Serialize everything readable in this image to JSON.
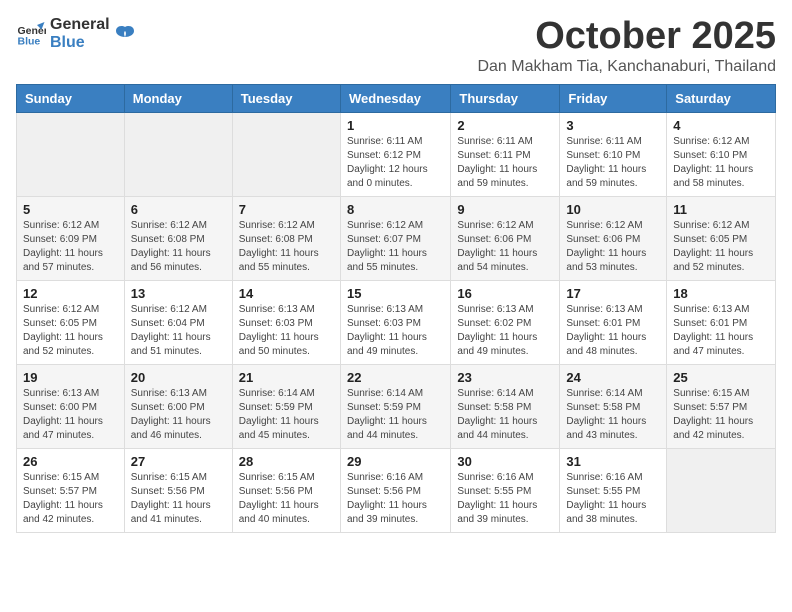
{
  "logo": {
    "general": "General",
    "blue": "Blue"
  },
  "header": {
    "month": "October 2025",
    "location": "Dan Makham Tia, Kanchanaburi, Thailand"
  },
  "weekdays": [
    "Sunday",
    "Monday",
    "Tuesday",
    "Wednesday",
    "Thursday",
    "Friday",
    "Saturday"
  ],
  "weeks": [
    [
      {
        "day": "",
        "sunrise": "",
        "sunset": "",
        "daylight": ""
      },
      {
        "day": "",
        "sunrise": "",
        "sunset": "",
        "daylight": ""
      },
      {
        "day": "",
        "sunrise": "",
        "sunset": "",
        "daylight": ""
      },
      {
        "day": "1",
        "sunrise": "Sunrise: 6:11 AM",
        "sunset": "Sunset: 6:12 PM",
        "daylight": "Daylight: 12 hours and 0 minutes."
      },
      {
        "day": "2",
        "sunrise": "Sunrise: 6:11 AM",
        "sunset": "Sunset: 6:11 PM",
        "daylight": "Daylight: 11 hours and 59 minutes."
      },
      {
        "day": "3",
        "sunrise": "Sunrise: 6:11 AM",
        "sunset": "Sunset: 6:10 PM",
        "daylight": "Daylight: 11 hours and 59 minutes."
      },
      {
        "day": "4",
        "sunrise": "Sunrise: 6:12 AM",
        "sunset": "Sunset: 6:10 PM",
        "daylight": "Daylight: 11 hours and 58 minutes."
      }
    ],
    [
      {
        "day": "5",
        "sunrise": "Sunrise: 6:12 AM",
        "sunset": "Sunset: 6:09 PM",
        "daylight": "Daylight: 11 hours and 57 minutes."
      },
      {
        "day": "6",
        "sunrise": "Sunrise: 6:12 AM",
        "sunset": "Sunset: 6:08 PM",
        "daylight": "Daylight: 11 hours and 56 minutes."
      },
      {
        "day": "7",
        "sunrise": "Sunrise: 6:12 AM",
        "sunset": "Sunset: 6:08 PM",
        "daylight": "Daylight: 11 hours and 55 minutes."
      },
      {
        "day": "8",
        "sunrise": "Sunrise: 6:12 AM",
        "sunset": "Sunset: 6:07 PM",
        "daylight": "Daylight: 11 hours and 55 minutes."
      },
      {
        "day": "9",
        "sunrise": "Sunrise: 6:12 AM",
        "sunset": "Sunset: 6:06 PM",
        "daylight": "Daylight: 11 hours and 54 minutes."
      },
      {
        "day": "10",
        "sunrise": "Sunrise: 6:12 AM",
        "sunset": "Sunset: 6:06 PM",
        "daylight": "Daylight: 11 hours and 53 minutes."
      },
      {
        "day": "11",
        "sunrise": "Sunrise: 6:12 AM",
        "sunset": "Sunset: 6:05 PM",
        "daylight": "Daylight: 11 hours and 52 minutes."
      }
    ],
    [
      {
        "day": "12",
        "sunrise": "Sunrise: 6:12 AM",
        "sunset": "Sunset: 6:05 PM",
        "daylight": "Daylight: 11 hours and 52 minutes."
      },
      {
        "day": "13",
        "sunrise": "Sunrise: 6:12 AM",
        "sunset": "Sunset: 6:04 PM",
        "daylight": "Daylight: 11 hours and 51 minutes."
      },
      {
        "day": "14",
        "sunrise": "Sunrise: 6:13 AM",
        "sunset": "Sunset: 6:03 PM",
        "daylight": "Daylight: 11 hours and 50 minutes."
      },
      {
        "day": "15",
        "sunrise": "Sunrise: 6:13 AM",
        "sunset": "Sunset: 6:03 PM",
        "daylight": "Daylight: 11 hours and 49 minutes."
      },
      {
        "day": "16",
        "sunrise": "Sunrise: 6:13 AM",
        "sunset": "Sunset: 6:02 PM",
        "daylight": "Daylight: 11 hours and 49 minutes."
      },
      {
        "day": "17",
        "sunrise": "Sunrise: 6:13 AM",
        "sunset": "Sunset: 6:01 PM",
        "daylight": "Daylight: 11 hours and 48 minutes."
      },
      {
        "day": "18",
        "sunrise": "Sunrise: 6:13 AM",
        "sunset": "Sunset: 6:01 PM",
        "daylight": "Daylight: 11 hours and 47 minutes."
      }
    ],
    [
      {
        "day": "19",
        "sunrise": "Sunrise: 6:13 AM",
        "sunset": "Sunset: 6:00 PM",
        "daylight": "Daylight: 11 hours and 47 minutes."
      },
      {
        "day": "20",
        "sunrise": "Sunrise: 6:13 AM",
        "sunset": "Sunset: 6:00 PM",
        "daylight": "Daylight: 11 hours and 46 minutes."
      },
      {
        "day": "21",
        "sunrise": "Sunrise: 6:14 AM",
        "sunset": "Sunset: 5:59 PM",
        "daylight": "Daylight: 11 hours and 45 minutes."
      },
      {
        "day": "22",
        "sunrise": "Sunrise: 6:14 AM",
        "sunset": "Sunset: 5:59 PM",
        "daylight": "Daylight: 11 hours and 44 minutes."
      },
      {
        "day": "23",
        "sunrise": "Sunrise: 6:14 AM",
        "sunset": "Sunset: 5:58 PM",
        "daylight": "Daylight: 11 hours and 44 minutes."
      },
      {
        "day": "24",
        "sunrise": "Sunrise: 6:14 AM",
        "sunset": "Sunset: 5:58 PM",
        "daylight": "Daylight: 11 hours and 43 minutes."
      },
      {
        "day": "25",
        "sunrise": "Sunrise: 6:15 AM",
        "sunset": "Sunset: 5:57 PM",
        "daylight": "Daylight: 11 hours and 42 minutes."
      }
    ],
    [
      {
        "day": "26",
        "sunrise": "Sunrise: 6:15 AM",
        "sunset": "Sunset: 5:57 PM",
        "daylight": "Daylight: 11 hours and 42 minutes."
      },
      {
        "day": "27",
        "sunrise": "Sunrise: 6:15 AM",
        "sunset": "Sunset: 5:56 PM",
        "daylight": "Daylight: 11 hours and 41 minutes."
      },
      {
        "day": "28",
        "sunrise": "Sunrise: 6:15 AM",
        "sunset": "Sunset: 5:56 PM",
        "daylight": "Daylight: 11 hours and 40 minutes."
      },
      {
        "day": "29",
        "sunrise": "Sunrise: 6:16 AM",
        "sunset": "Sunset: 5:56 PM",
        "daylight": "Daylight: 11 hours and 39 minutes."
      },
      {
        "day": "30",
        "sunrise": "Sunrise: 6:16 AM",
        "sunset": "Sunset: 5:55 PM",
        "daylight": "Daylight: 11 hours and 39 minutes."
      },
      {
        "day": "31",
        "sunrise": "Sunrise: 6:16 AM",
        "sunset": "Sunset: 5:55 PM",
        "daylight": "Daylight: 11 hours and 38 minutes."
      },
      {
        "day": "",
        "sunrise": "",
        "sunset": "",
        "daylight": ""
      }
    ]
  ]
}
